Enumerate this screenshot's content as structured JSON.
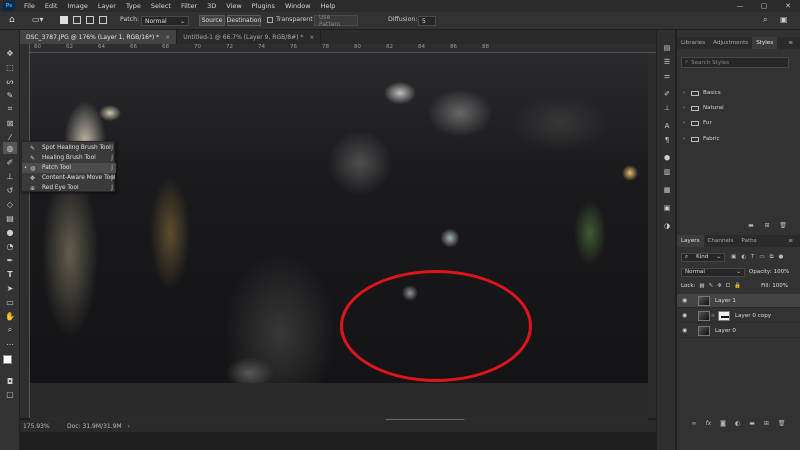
{
  "menubar": {
    "logo": "Ps",
    "items": [
      "File",
      "Edit",
      "Image",
      "Layer",
      "Type",
      "Select",
      "Filter",
      "3D",
      "View",
      "Plugins",
      "Window",
      "Help"
    ],
    "window_controls": [
      "—",
      "▢",
      "✕"
    ]
  },
  "options": {
    "patch_label": "Patch:",
    "patch_value": "Normal",
    "source_label": "Source",
    "destination_label": "Destination",
    "transparent_label": "Transparent",
    "use_pattern_label": "Use Pattern",
    "diffusion_label": "Diffusion:",
    "diffusion_value": "5"
  },
  "tabs": [
    {
      "label": "DSC_3787.JPG @ 176% (Layer 1, RGB/16*) *"
    },
    {
      "label": "Untitled-1 @ 66.7% (Layer 9, RGB/8#) *"
    }
  ],
  "ruler_marks": [
    "60",
    "62",
    "64",
    "66",
    "68",
    "70",
    "72",
    "74",
    "76",
    "78",
    "80",
    "82",
    "84",
    "86",
    "88"
  ],
  "flyout": [
    {
      "icon": "spot-healing-brush-icon",
      "label": "Spot Healing Brush Tool",
      "key": "J",
      "active": false
    },
    {
      "icon": "healing-brush-icon",
      "label": "Healing Brush Tool",
      "key": "J",
      "active": false
    },
    {
      "icon": "patch-icon",
      "label": "Patch Tool",
      "key": "J",
      "active": true
    },
    {
      "icon": "content-aware-move-icon",
      "label": "Content-Aware Move Tool",
      "key": "J",
      "active": false
    },
    {
      "icon": "red-eye-icon",
      "label": "Red Eye Tool",
      "key": "J",
      "active": false
    }
  ],
  "status": {
    "zoom": "175.93%",
    "doc": "Doc: 31.9M/31.9M"
  },
  "styles_panel": {
    "tabs": [
      "Libraries",
      "Adjustments",
      "Styles"
    ],
    "active_tab": "Styles",
    "search_placeholder": "Search Styles",
    "folders": [
      "Basics",
      "Natural",
      "Fur",
      "Fabric"
    ]
  },
  "layers_panel": {
    "tabs": [
      "Layers",
      "Channels",
      "Paths"
    ],
    "active_tab": "Layers",
    "kind_label": "Kind",
    "blend_mode": "Normal",
    "opacity_label": "Opacity:",
    "opacity_value": "100%",
    "lock_label": "Lock:",
    "fill_label": "Fill:",
    "fill_value": "100%",
    "layers": [
      {
        "name": "Layer 1",
        "selected": true,
        "has_mask": false
      },
      {
        "name": "Layer 0 copy",
        "selected": false,
        "has_mask": true
      },
      {
        "name": "Layer 0",
        "selected": false,
        "has_mask": false
      }
    ],
    "footer_icons": [
      "link-icon",
      "fx-icon",
      "mask-icon",
      "adjustment-icon",
      "group-icon",
      "new-layer-icon",
      "trash-icon"
    ]
  },
  "colors": {
    "annotation": "#e1141a",
    "accent": "#31a8ff"
  }
}
